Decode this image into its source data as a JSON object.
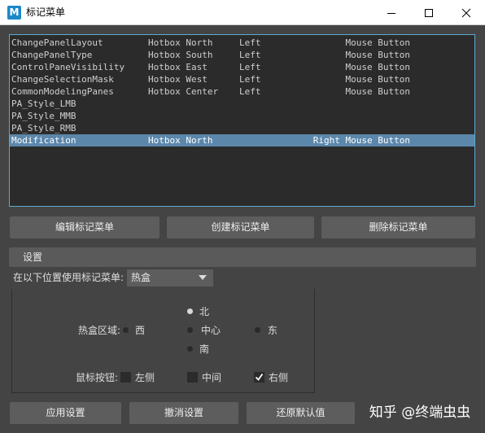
{
  "window": {
    "app_icon_letter": "M",
    "title": "标记菜单",
    "minimize_icon": "minimize-icon",
    "maximize_icon": "maximize-icon",
    "close_icon": "close-icon"
  },
  "marking_menus": [
    {
      "name": "ChangePanelLayout",
      "location": "Hotbox North",
      "side": "Left",
      "button": "Mouse Button",
      "selected": false
    },
    {
      "name": "ChangePanelType",
      "location": "Hotbox South",
      "side": "Left",
      "button": "Mouse Button",
      "selected": false
    },
    {
      "name": "ControlPaneVisibility",
      "location": "Hotbox East",
      "side": "Left",
      "button": "Mouse Button",
      "selected": false
    },
    {
      "name": "ChangeSelectionMask",
      "location": "Hotbox West",
      "side": "Left",
      "button": "Mouse Button",
      "selected": false
    },
    {
      "name": "CommonModelingPanes",
      "location": "Hotbox Center",
      "side": "Left",
      "button": "Mouse Button",
      "selected": false
    },
    {
      "name": "PA_Style_LMB",
      "location": "",
      "side": "",
      "button": "",
      "selected": false
    },
    {
      "name": "PA_Style_MMB",
      "location": "",
      "side": "",
      "button": "",
      "selected": false
    },
    {
      "name": "PA_Style_RMB",
      "location": "",
      "side": "",
      "button": "",
      "selected": false
    },
    {
      "name": "Modification",
      "location": "Hotbox North",
      "side": "",
      "button": "Right Mouse Button",
      "selected": true
    }
  ],
  "actions": {
    "edit": "编辑标记菜单",
    "create": "创建标记菜单",
    "delete": "删除标记菜单"
  },
  "settings": {
    "header": "设置",
    "use_label": "在以下位置使用标记菜单:",
    "use_value": "热盒",
    "region_label": "热盒区域:",
    "region_options": {
      "north": "北",
      "west": "西",
      "center": "中心",
      "east": "东",
      "south": "南"
    },
    "region_selected": "north",
    "mouse_label": "鼠标按钮:",
    "mouse_options": {
      "left": "左侧",
      "middle": "中间",
      "right": "右侧"
    },
    "mouse_checked": {
      "left": false,
      "middle": false,
      "right": true
    }
  },
  "footer": {
    "apply": "应用设置",
    "cancel": "撤消设置",
    "restore": "还原默认值"
  },
  "watermark": "知乎 @终端虫虫",
  "colors": {
    "background": "#444444",
    "list_background": "#2b2b2b",
    "selection": "#5b87ab",
    "list_border": "#5ea9d2",
    "button": "#5d5d5d"
  }
}
